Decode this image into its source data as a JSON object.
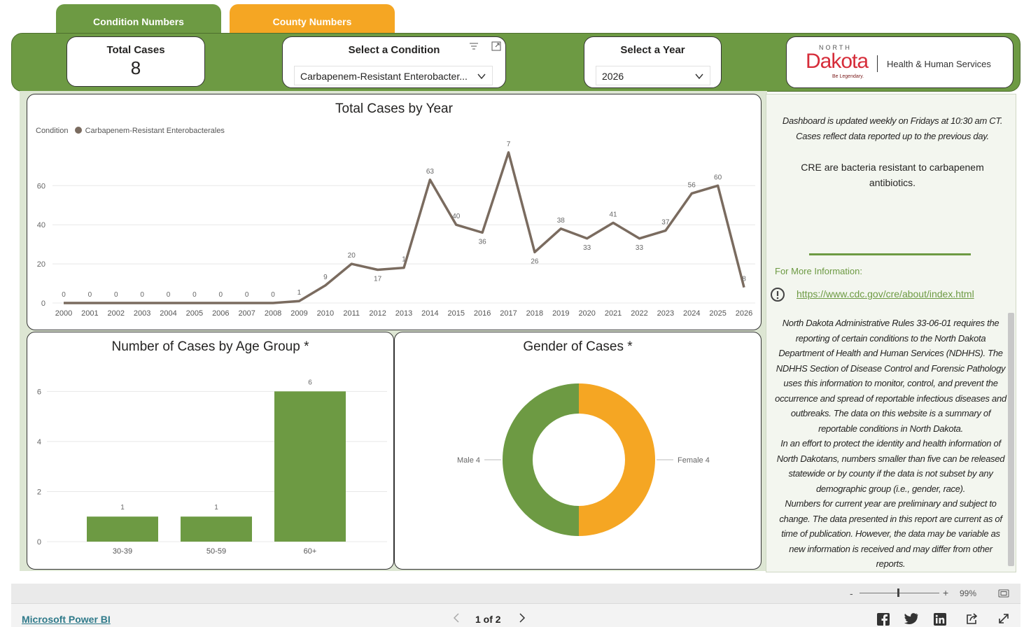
{
  "tabs": [
    {
      "label": "Condition Numbers",
      "color": "#6d9a43"
    },
    {
      "label": "County Numbers",
      "color": "#f5a623"
    }
  ],
  "header": {
    "total_cases_label": "Total Cases",
    "total_cases_value": "8",
    "condition_label": "Select a Condition",
    "condition_value": "Carbapenem-Resistant Enterobacter...",
    "year_label": "Select a Year",
    "year_value": "2026",
    "logo": {
      "north": "NORTH",
      "dakota": "Dakota",
      "tagline": "Be Legendary.",
      "org": "Health & Human Services"
    }
  },
  "line_panel": {
    "title": "Total Cases by Year",
    "legend_label": "Condition",
    "legend_series": "Carbapenem-Resistant Enterobacterales"
  },
  "age_panel": {
    "title": "Number of Cases by Age Group *"
  },
  "gender_panel": {
    "title": "Gender of Cases *"
  },
  "chart_data": [
    {
      "type": "line",
      "title": "Total Cases by Year",
      "legend_title": "Condition",
      "x": [
        "2000",
        "2001",
        "2002",
        "2003",
        "2004",
        "2005",
        "2006",
        "2007",
        "2008",
        "2009",
        "2010",
        "2011",
        "2012",
        "2013",
        "2014",
        "2015",
        "2016",
        "2017",
        "2018",
        "2019",
        "2020",
        "2021",
        "2022",
        "2023",
        "2024",
        "2025",
        "2026"
      ],
      "series": [
        {
          "name": "Carbapenem-Resistant Enterobacterales",
          "color": "#7a6b5f",
          "values": [
            0,
            0,
            0,
            0,
            0,
            0,
            0,
            0,
            0,
            1,
            9,
            20,
            17,
            18,
            63,
            40,
            36,
            77,
            26,
            38,
            33,
            41,
            33,
            37,
            56,
            60,
            8
          ],
          "labels": [
            "0",
            "0",
            "0",
            "0",
            "0",
            "0",
            "0",
            "0",
            "0",
            "1",
            "9",
            "20",
            "17",
            "1",
            "63",
            "40",
            "36",
            "7",
            "26",
            "38",
            "33",
            "41",
            "33",
            "37",
            "56",
            "60",
            "8"
          ]
        }
      ],
      "yticks": [
        0,
        20,
        40,
        60
      ],
      "ylim": [
        0,
        78
      ],
      "grid": true
    },
    {
      "type": "bar",
      "title": "Number of Cases by Age Group *",
      "categories": [
        "30-39",
        "50-59",
        "60+"
      ],
      "values": [
        1,
        1,
        6
      ],
      "color": "#6d9a43",
      "yticks": [
        0,
        2,
        4,
        6
      ],
      "ylim": [
        0,
        6.4
      ],
      "grid": true
    },
    {
      "type": "pie",
      "title": "Gender of Cases *",
      "donut": true,
      "slices": [
        {
          "label": "Female 4",
          "value": 4,
          "color": "#f5a623"
        },
        {
          "label": "Male 4",
          "value": 4,
          "color": "#6d9a43"
        }
      ]
    }
  ],
  "info": {
    "update_note": "Dashboard is updated weekly on Fridays at 10:30 am CT. Cases reflect data reported up to the previous day.",
    "description": "CRE are bacteria resistant to carbapenem antibiotics.",
    "more_info_label": "For More Information:",
    "link": "https://www.cdc.gov/cre/about/index.html",
    "rules_p1": "North Dakota Administrative Rules 33-06-01 requires the reporting of certain conditions to the North Dakota Department of Health and Human Services (NDHHS). The NDHHS Section of Disease Control and Forensic Pathology uses this information to monitor, control, and prevent the occurrence and spread of reportable infectious diseases and outbreaks. The data on this website is a summary of reportable conditions in North Dakota.",
    "rules_p2": "In an effort to protect the identity and health information of North Dakotans, numbers smaller than five can be released statewide or by county if the data is not subset by any demographic group (i.e., gender, race).",
    "rules_p3": "Numbers for current year are preliminary and subject to change.  The data presented in this report are current as of time of publication. However, the data may be variable as new information is received and may differ from other reports."
  },
  "footer": {
    "zoom_minus": "-",
    "zoom_plus": "+",
    "zoom_level": "99%",
    "brand_link": "Microsoft Power BI",
    "page_indicator": "1 of 2"
  },
  "colors": {
    "green": "#6d9a43",
    "orange": "#f5a623",
    "line": "#7a6b5f",
    "panel_bg": "#dde6d3"
  }
}
